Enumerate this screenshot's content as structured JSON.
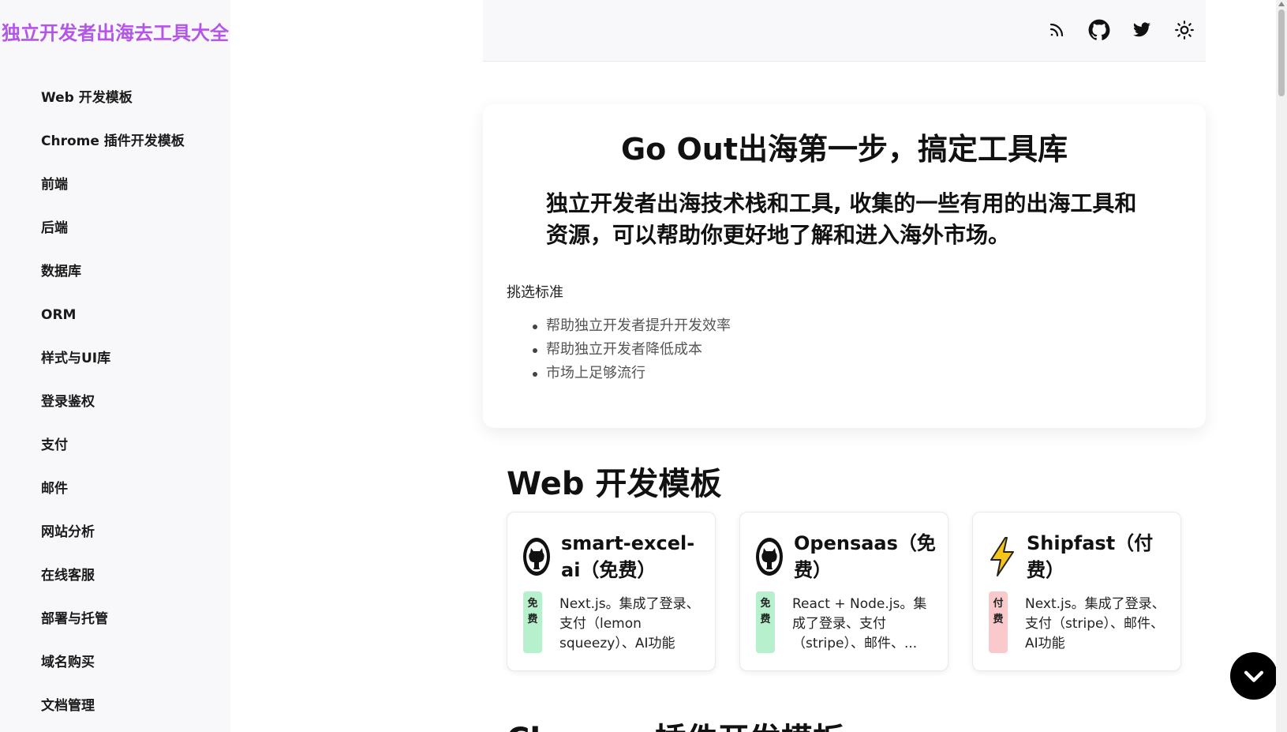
{
  "site": {
    "title": "独立开发者出海去工具大全"
  },
  "sidebar": {
    "items": [
      {
        "label": "Web 开发模板"
      },
      {
        "label": "Chrome 插件开发模板"
      },
      {
        "label": "前端"
      },
      {
        "label": "后端"
      },
      {
        "label": "数据库"
      },
      {
        "label": "ORM"
      },
      {
        "label": "样式与UI库"
      },
      {
        "label": "登录鉴权"
      },
      {
        "label": "支付"
      },
      {
        "label": "邮件"
      },
      {
        "label": "网站分析"
      },
      {
        "label": "在线客服"
      },
      {
        "label": "部署与托管"
      },
      {
        "label": "域名购买"
      },
      {
        "label": "文档管理"
      }
    ]
  },
  "header": {
    "icons": [
      "rss-icon",
      "github-icon",
      "twitter-icon",
      "sun-icon"
    ]
  },
  "hero": {
    "title": "Go Out出海第一步，搞定工具库",
    "subtitle": "独立开发者出海技术栈和工具, 收集的一些有用的出海工具和资源，可以帮助你更好地了解和进入海外市场。",
    "criteria_label": "挑选标准",
    "criteria": [
      "帮助独立开发者提升开发效率",
      "帮助独立开发者降低成本",
      "市场上足够流行"
    ]
  },
  "sections": [
    {
      "title": "Web 开发模板",
      "cards": [
        {
          "title": "smart-excel-ai（免费）",
          "badge": "免费",
          "description": "Next.js。集成了登录、支付（lemon squeezy）、AI功能",
          "icon": "github-icon"
        },
        {
          "title": "Opensaas（免费）",
          "badge": "免费",
          "description": "React + Node.js。集成了登录、支付（stripe）、邮件、...",
          "icon": "github-icon"
        },
        {
          "title": "Shipfast（付费）",
          "badge": "付费",
          "description": "Next.js。集成了登录、支付（stripe）、邮件、AI功能",
          "icon": "lightning-icon"
        }
      ]
    },
    {
      "title": "Chrome 插件开发模板"
    }
  ],
  "colors": {
    "brand": "#b455ea",
    "badge_free": "#b7f0cd",
    "badge_paid": "#f9c9cc"
  },
  "fab": {
    "icon": "chevron-down-icon"
  }
}
